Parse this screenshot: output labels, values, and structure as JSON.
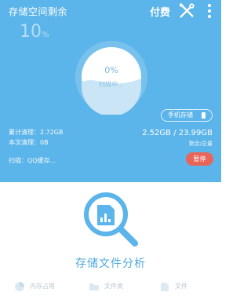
{
  "header": {
    "title": "存储空间剩余",
    "pay_label": "付费",
    "tools_icon": "wrench-screwdriver-icon",
    "menu_icon": "more-vertical-icon"
  },
  "summary": {
    "free_percent": "10",
    "percent_unit": "%"
  },
  "scan_gauge": {
    "progress_value": "0%",
    "progress": 0,
    "status": "扫描中..."
  },
  "storage": {
    "selector_label": "手机存储",
    "selector_icon": "phone-icon",
    "cleaned_total": "累计清理：2.72GB",
    "cleaned_now": "本次清理：0B",
    "capacity": "2.52GB / 23.99GB",
    "capacity_label": "剩余/总量",
    "scan_target": "扫描：QQ缓存..."
  },
  "actions": {
    "pause_label": "暂停"
  },
  "analysis": {
    "icon": "file-analysis-magnifier-icon",
    "label": "存储文件分析"
  },
  "bottom_tabs": [
    {
      "label": "内存占用",
      "icon": "pie-chart-icon"
    },
    {
      "label": "文件类",
      "icon": "folder-icon"
    },
    {
      "label": "文件",
      "icon": "file-icon"
    }
  ],
  "colors": {
    "primary": "#5bb4ea",
    "accent": "#4fa8e0",
    "danger": "#e8655a"
  }
}
